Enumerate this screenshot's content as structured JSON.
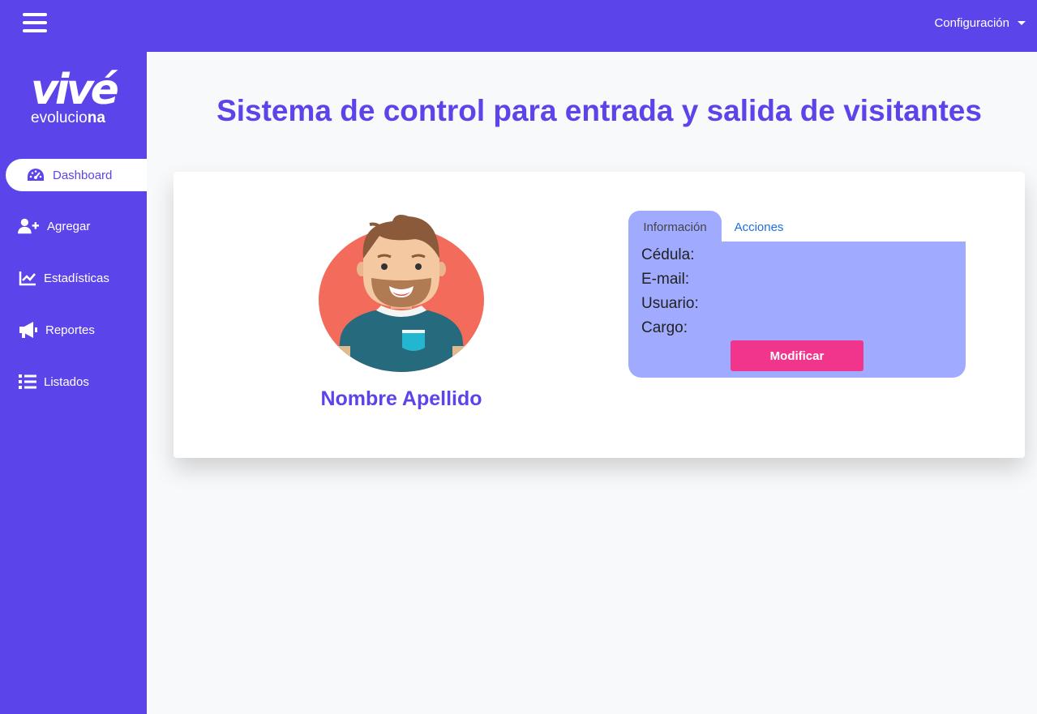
{
  "topbar": {
    "config_label": "Configuración"
  },
  "logo": {
    "main": "vivé",
    "sub_regular": "evolucio",
    "sub_bold": "na"
  },
  "sidebar": {
    "items": [
      {
        "label": "Dashboard",
        "icon": "tachometer-icon",
        "active": true
      },
      {
        "label": "Agregar",
        "icon": "user-plus-icon"
      },
      {
        "label": "Estadísticas",
        "icon": "chart-line-icon"
      },
      {
        "label": "Reportes",
        "icon": "megaphone-icon"
      },
      {
        "label": "Listados",
        "icon": "list-icon"
      }
    ]
  },
  "main": {
    "title": "Sistema de control para entrada y salida de visitantes"
  },
  "profile": {
    "name": "Nombre Apellido",
    "tabs": [
      {
        "label": "Información",
        "active": true
      },
      {
        "label": "Acciones"
      }
    ],
    "fields": [
      "Cédula:",
      "E-mail:",
      "Usuario:",
      "Cargo:"
    ],
    "button_label": "Modificar"
  },
  "colors": {
    "primary": "#5b45ea",
    "panel": "#a0abff",
    "accent": "#f1348c",
    "link": "#1d6fe0"
  }
}
